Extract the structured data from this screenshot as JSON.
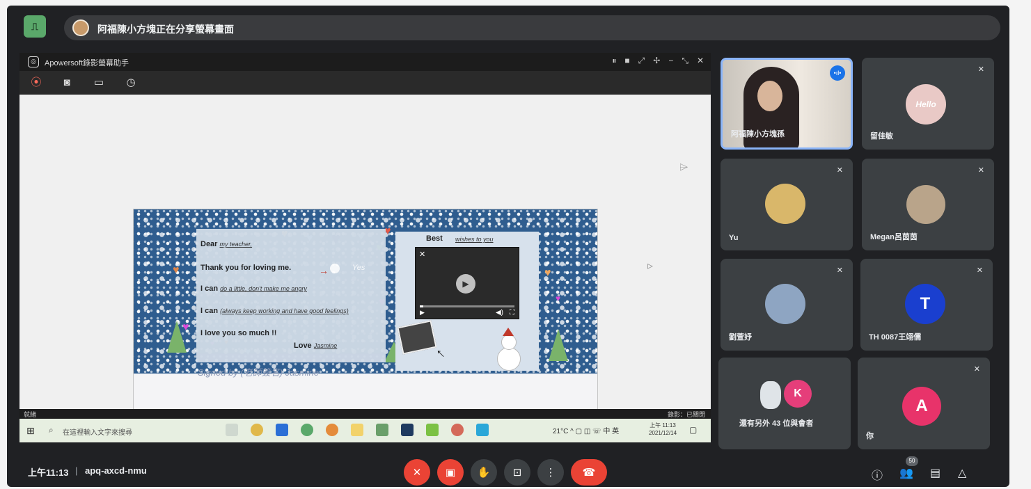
{
  "presentation": {
    "banner_text": "阿福陳小方塊正在分享螢幕畫面",
    "app_icon": "present-icon"
  },
  "shared_window": {
    "title": "Apowersoft錄影螢幕助手",
    "win_controls": [
      "⏸",
      "■",
      "⤢",
      "✢",
      "−",
      "⤡",
      "✕"
    ],
    "tools": [
      "record-icon",
      "camera-icon",
      "folder-icon",
      "clock-icon"
    ],
    "status_left": "就緒",
    "status_right": "錄影：已關閉"
  },
  "card": {
    "line_dear": "Dear",
    "line_dear_hand": "my teacher,",
    "line_thanks": "Thank you for loving me.",
    "yes_tag": "Yes",
    "line_ican1": "I can",
    "line_ican1_hand": "do a little, don't make me angry",
    "line_ican2": "I can",
    "line_ican2_hand": "(always keep working and have good feelings)",
    "line_love": "I love you so much !!",
    "line_love_sign": "Love",
    "line_love_sign_hand": "Jasmine",
    "best_label": "Best",
    "best_hand": "wishes to you",
    "signed_line": "Signed by (老師簽名) Jasmine"
  },
  "taskbar": {
    "search_placeholder": "在這裡輸入文字來搜尋",
    "tray_text": "21°C  ^  ▢  ◫  ☏  中  英",
    "clock_time": "上午 11:13",
    "clock_date": "2021/12/14"
  },
  "participants": [
    {
      "name": "阿福陳小方塊孫",
      "speaking": true
    },
    {
      "name": "留佳敏",
      "avatar_text": "Hello",
      "avatar_color": "#e9c9c6",
      "muted": true
    },
    {
      "name": "Yu",
      "muted": true
    },
    {
      "name": "Megan呂茵茵",
      "muted": true
    },
    {
      "name": "劉萱妤",
      "muted": true
    },
    {
      "name": "TH 0087王翊儒",
      "avatar_text": "T",
      "avatar_color": "#1a3fcf",
      "muted": true
    },
    {
      "name": "還有另外 43 位與會者",
      "avatar_text": "K",
      "avatar_color": "#e53e7a"
    },
    {
      "name": "你",
      "avatar_text": "A",
      "avatar_color": "#e8336a",
      "muted": true
    }
  ],
  "bottom_bar": {
    "time": "上午11:13",
    "separator": "|",
    "meeting_code": "apq-axcd-nmu",
    "people_count": "50",
    "controls": [
      "mic-off-icon",
      "camera-off-icon",
      "raise-hand-icon",
      "present-screen-icon",
      "more-options-icon",
      "hang-up-icon"
    ],
    "right_controls": [
      "info-icon",
      "people-icon",
      "chat-icon",
      "activities-icon"
    ]
  },
  "colors": {
    "meet_bg": "#202124",
    "tile_bg": "#3c4043",
    "danger": "#ea4335",
    "accent": "#1a73e8"
  }
}
